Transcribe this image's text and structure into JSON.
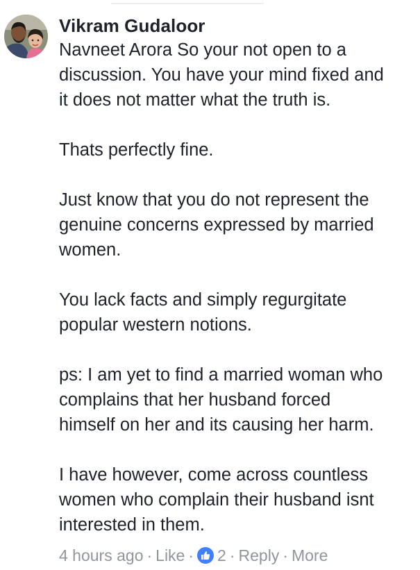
{
  "comment": {
    "author": "Vikram Gudaloor",
    "paragraphs": [
      {
        "lines": [
          "Navneet Arora So your not open to a",
          "discussion. You have your mind fixed and",
          "it does not matter what the truth is."
        ]
      },
      {
        "lines": [
          "Thats perfectly fine."
        ]
      },
      {
        "lines": [
          "Just know that you do not represent the",
          "genuine concerns expressed by married",
          "women."
        ]
      },
      {
        "lines": [
          "You lack facts and simply regurgitate",
          "popular western notions."
        ]
      },
      {
        "lines": [
          "ps: I am yet to find a married woman who",
          "complains that her husband forced",
          "himself on her and its causing her harm."
        ]
      },
      {
        "lines": [
          "I have however, come across countless",
          "women who complain their husband isnt",
          "interested in them."
        ]
      }
    ],
    "meta": {
      "timestamp": "4 hours ago",
      "like_label": "Like",
      "reaction_count": "2",
      "reply_label": "Reply",
      "more_label": "More",
      "separator": "·"
    },
    "colors": {
      "text": "#1d2129",
      "meta": "#90949c",
      "like_badge": "#4080ff"
    },
    "icons": {
      "avatar": "profile-photo",
      "reaction": "thumbs-up-icon"
    }
  }
}
